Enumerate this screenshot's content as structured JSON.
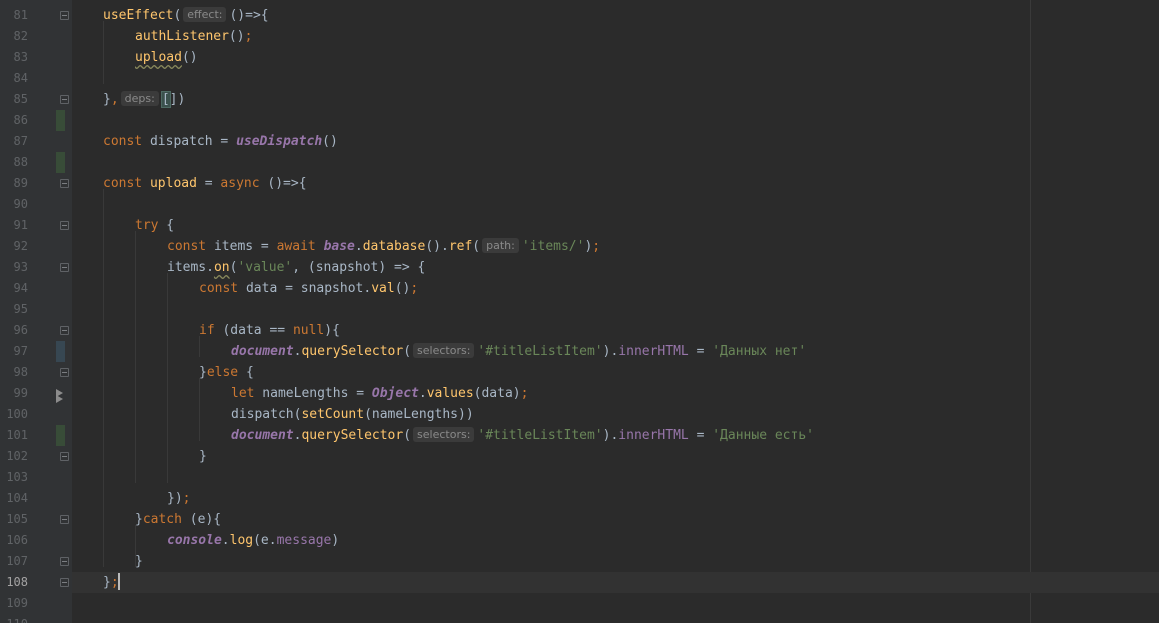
{
  "editor": {
    "current_line": "108",
    "lines": [
      {
        "n": "81",
        "fold": true,
        "vcs": "",
        "run": false,
        "code": "useEffect(",
        "tokens": []
      },
      {
        "n": "82"
      },
      {
        "n": "83"
      },
      {
        "n": "84"
      },
      {
        "n": "85"
      },
      {
        "n": "86"
      },
      {
        "n": "87"
      },
      {
        "n": "88"
      },
      {
        "n": "89"
      },
      {
        "n": "90"
      },
      {
        "n": "91"
      },
      {
        "n": "92"
      },
      {
        "n": "93"
      },
      {
        "n": "94"
      },
      {
        "n": "95"
      },
      {
        "n": "96"
      },
      {
        "n": "97"
      },
      {
        "n": "98"
      },
      {
        "n": "99"
      },
      {
        "n": "100"
      },
      {
        "n": "101"
      },
      {
        "n": "102"
      },
      {
        "n": "103"
      },
      {
        "n": "104"
      },
      {
        "n": "105"
      },
      {
        "n": "106"
      },
      {
        "n": "107"
      },
      {
        "n": "108"
      },
      {
        "n": "109"
      },
      {
        "n": "110"
      }
    ]
  },
  "code": {
    "l81": {
      "fn": "useEffect",
      "open": "(",
      "hint": "effect:",
      "rest": "()=>{"
    },
    "l82": {
      "fn": "authListener",
      "rest": "();",
      "semi": ";"
    },
    "l83": {
      "fn": "upload",
      "rest": "()"
    },
    "l85": {
      "close": "},",
      "hint": "deps:",
      "rest": "[])"
    },
    "l87": {
      "kw": "const",
      "name": " dispatch = ",
      "fn": "useDispatch",
      "rest": "()"
    },
    "l89": {
      "kw": "const",
      "name": "upload",
      "eq": " = ",
      "kw2": "async",
      "rest": " ()=>{"
    },
    "l91": {
      "kw": "try",
      "rest": " {"
    },
    "l92": {
      "kw": "const",
      "name": " items = ",
      "kw2": "await",
      "gl": "base",
      "p1": ".",
      "fn1": "database",
      "p2": "().",
      "fn2": "ref",
      "open": "(",
      "hint": "path:",
      "str": "'items/'",
      "rest": ");"
    },
    "l93": {
      "name": "items.",
      "fn": "on",
      "open": "(",
      "str": "'value'",
      "rest": ", (snapshot) => {"
    },
    "l94": {
      "kw": "const",
      "name": " data = snapshot.",
      "fn": "val",
      "rest": "();"
    },
    "l96": {
      "kw": "if",
      "name": " (data == ",
      "kw2": "null",
      "rest": "){"
    },
    "l97": {
      "gl": "document",
      "p1": ".",
      "fn": "querySelector",
      "open": "(",
      "hint": "selectors:",
      "str": "'#titleListItem'",
      "p2": ").",
      "pr": "innerHTML",
      "eq": " = ",
      "str2": "'Данных нет'"
    },
    "l98": {
      "close": "}",
      "kw": "else",
      "rest": " {"
    },
    "l99": {
      "kw": "let",
      "name": " nameLengths = ",
      "gl": "Object",
      "p1": ".",
      "fn": "values",
      "rest": "(data);"
    },
    "l100": {
      "name": "dispatch(",
      "fn": "setCount",
      "rest": "(nameLengths))"
    },
    "l101": {
      "gl": "document",
      "p1": ".",
      "fn": "querySelector",
      "open": "(",
      "hint": "selectors:",
      "str": "'#titleListItem'",
      "p2": ").",
      "pr": "innerHTML",
      "eq": " = ",
      "str2": "'Данные есть'"
    },
    "l102": {
      "close": "}"
    },
    "l104": {
      "close": "});"
    },
    "l105": {
      "close": "}",
      "kw": "catch",
      "rest": " (e){"
    },
    "l106": {
      "gl": "console",
      "p1": ".",
      "fn": "log",
      "rest": "(e.",
      "pr": "message",
      "end": ")"
    },
    "l107": {
      "close": "}"
    },
    "l108": {
      "close": "};"
    }
  },
  "colors": {
    "background": "#2b2b2b",
    "gutter": "#313335",
    "keyword": "#cc7832",
    "function": "#ffc66d",
    "string": "#6a8759",
    "global": "#9876aa",
    "text": "#a9b7c6"
  }
}
